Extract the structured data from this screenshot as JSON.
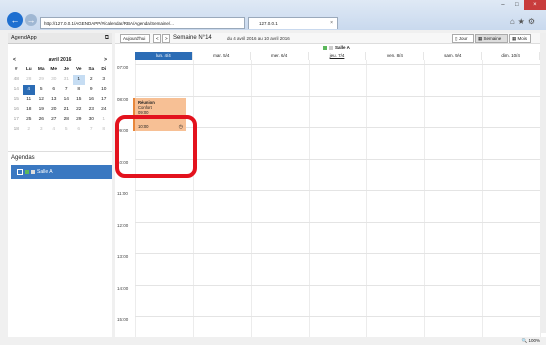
{
  "browser": {
    "address": "http://127.0.0.1/AGENDAPP/#/calendar/RBA/Agenda/Semaine/...",
    "tab_title": "127.0.0.1",
    "tab_close": "×",
    "back_glyph": "←",
    "forward_glyph": "→"
  },
  "sidebar": {
    "app_title": "AgendApp",
    "mini_calendar": {
      "month_label": "avril 2016",
      "prev": "<",
      "next": ">",
      "headers": [
        "#",
        "Lu",
        "Ma",
        "Me",
        "Je",
        "Ve",
        "Sa",
        "Di"
      ],
      "rows": [
        [
          "48",
          "28",
          "29",
          "30",
          "31",
          "1",
          "2",
          "3"
        ],
        [
          "14",
          "4",
          "5",
          "6",
          "7",
          "8",
          "9",
          "10"
        ],
        [
          "15",
          "11",
          "12",
          "13",
          "14",
          "15",
          "16",
          "17"
        ],
        [
          "16",
          "18",
          "19",
          "20",
          "21",
          "22",
          "23",
          "24"
        ],
        [
          "17",
          "25",
          "26",
          "27",
          "28",
          "29",
          "30",
          "1"
        ],
        [
          "18",
          "2",
          "3",
          "4",
          "5",
          "6",
          "7",
          "8"
        ]
      ]
    },
    "agendas_label": "Agendas",
    "agenda_item": "Salle A"
  },
  "toolbar": {
    "today": "Aujourd'hui",
    "prev": "<",
    "next": ">",
    "week_title": "Semaine N°14",
    "week_range": "du 4 avril 2016 au 10 avril 2016",
    "view_day": "Jour",
    "view_week": "Semaine",
    "view_month": "Mois"
  },
  "calendar": {
    "room": "Salle A",
    "days": [
      "lun. 4/4",
      "mar. 5/4",
      "mer. 6/4",
      "jeu. 7/4",
      "ven. 8/4",
      "sam. 9/4",
      "dim. 10/4"
    ],
    "hours": [
      "07:00",
      "08:00",
      "09:00",
      "10:00",
      "11:00",
      "12:00",
      "13:00",
      "14:00",
      "15:00"
    ],
    "event": {
      "title": "Réunion",
      "subtitle": "Confort",
      "start": "09:00",
      "end": "10:00"
    }
  },
  "status": {
    "zoom": "100%"
  },
  "colors": {
    "accent": "#2b6cb5",
    "event_bg": "#f7c095",
    "highlight": "#e3121d"
  }
}
